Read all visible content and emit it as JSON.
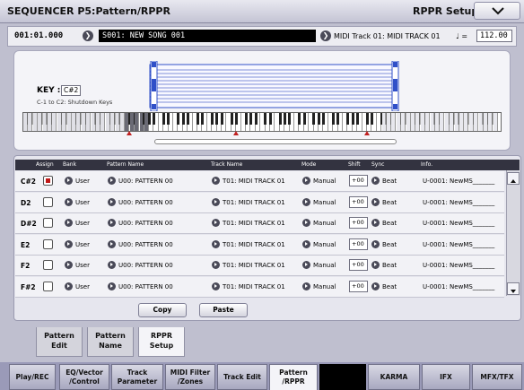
{
  "header": {
    "title": "SEQUENCER P5:Pattern/RPPR",
    "menu_label": "RPPR Setup"
  },
  "position": {
    "location": "001:01.000",
    "song": "S001: NEW SONG 001",
    "track": "MIDI Track 01: MIDI TRACK 01",
    "tempo_symbol": "♩ =",
    "tempo": "112.00"
  },
  "keyboard": {
    "key_label": "KEY :",
    "key_value": "C#2",
    "shutdown": "C-1 to C2: Shutdown Keys",
    "range_marks": [
      "T",
      "BOTTOM",
      "T",
      "TOP"
    ]
  },
  "table": {
    "headers": [
      "Assign",
      "Bank",
      "Pattern Name",
      "Track Name",
      "Mode",
      "Shift",
      "Sync",
      "Info."
    ],
    "rows": [
      {
        "key": "C#2",
        "assign": true,
        "bank": "User",
        "pattern": "U00: PATTERN 00",
        "track": "T01: MIDI TRACK 01",
        "mode": "Manual",
        "shift": "+00",
        "sync": "Beat",
        "info": "U-0001: NewMS_______"
      },
      {
        "key": "D2",
        "assign": false,
        "bank": "User",
        "pattern": "U00: PATTERN 00",
        "track": "T01: MIDI TRACK 01",
        "mode": "Manual",
        "shift": "+00",
        "sync": "Beat",
        "info": "U-0001: NewMS_______"
      },
      {
        "key": "D#2",
        "assign": false,
        "bank": "User",
        "pattern": "U00: PATTERN 00",
        "track": "T01: MIDI TRACK 01",
        "mode": "Manual",
        "shift": "+00",
        "sync": "Beat",
        "info": "U-0001: NewMS_______"
      },
      {
        "key": "E2",
        "assign": false,
        "bank": "User",
        "pattern": "U00: PATTERN 00",
        "track": "T01: MIDI TRACK 01",
        "mode": "Manual",
        "shift": "+00",
        "sync": "Beat",
        "info": "U-0001: NewMS_______"
      },
      {
        "key": "F2",
        "assign": false,
        "bank": "User",
        "pattern": "U00: PATTERN 00",
        "track": "T01: MIDI TRACK 01",
        "mode": "Manual",
        "shift": "+00",
        "sync": "Beat",
        "info": "U-0001: NewMS_______"
      },
      {
        "key": "F#2",
        "assign": false,
        "bank": "User",
        "pattern": "U00: PATTERN 00",
        "track": "T01: MIDI TRACK 01",
        "mode": "Manual",
        "shift": "+00",
        "sync": "Beat",
        "info": "U-0001: NewMS_______"
      }
    ],
    "copy_label": "Copy",
    "paste_label": "Paste"
  },
  "page_tabs": [
    {
      "label": "Pattern Edit",
      "active": false
    },
    {
      "label": "Pattern Name",
      "active": false
    },
    {
      "label": "RPPR Setup",
      "active": true
    }
  ],
  "bottom_tabs": [
    {
      "label": "Play/REC",
      "active": false
    },
    {
      "label": "EQ/Vector /Control",
      "active": false
    },
    {
      "label": "Track Parameter",
      "active": false
    },
    {
      "label": "MIDI Filter /Zones",
      "active": false
    },
    {
      "label": "Track Edit",
      "active": false
    },
    {
      "label": "Pattern /RPPR",
      "active": true
    },
    {
      "label": "",
      "active": false
    },
    {
      "label": "KARMA",
      "active": false
    },
    {
      "label": "IFX",
      "active": false
    },
    {
      "label": "MFX/TFX",
      "active": false
    }
  ],
  "colors": {
    "accent_red": "#c01818",
    "header_dark": "#333340",
    "range_blue": "#3050c8"
  }
}
